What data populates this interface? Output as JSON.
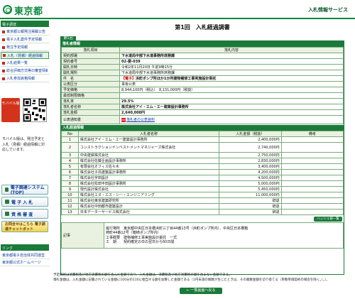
{
  "header": {
    "logo_text": "東京都",
    "service": "入札情報サービス"
  },
  "sidebar": {
    "menu_title": "電子調達",
    "menu_items": [
      {
        "label": "東京都公報発注掲載公告",
        "boxed": false
      },
      {
        "label": "電子入札案件予定情報",
        "boxed": false
      },
      {
        "label": "発注予定情報",
        "boxed": false
      },
      {
        "label": "入札（見積）経過情報",
        "boxed": true
      },
      {
        "label": "入札結果一覧",
        "boxed": false
      },
      {
        "label": "総合評価方式等の審査情報",
        "boxed": false
      },
      {
        "label": "入札参加資格情報",
        "boxed": false
      }
    ],
    "mobile_label": "モバイル版",
    "mobile_note": "モバイル版は、発注予定と入札（見積）経過情報に対応しています。",
    "system_buttons": [
      {
        "label": "電子調達システム(TOP)"
      },
      {
        "label": "電 子 入 札"
      },
      {
        "label": "資 格 審 査"
      }
    ],
    "gold_button": "お問合せはこちら 電子調達チャットボット",
    "links_title": "リンク",
    "links": [
      "東京都電子自治体共同運営",
      "東京都公式ホームページ"
    ]
  },
  "main": {
    "page_title": "第1回　入札経過調書",
    "round_tab": "第1回",
    "section_info": "落札者情報",
    "info_header": {
      "item": "落札項目",
      "content": "落札内容"
    },
    "info_rows": [
      {
        "label": "契約部署",
        "value": "下水道局中部下水道事務所庶務課",
        "bold": true
      },
      {
        "label": "契約番号",
        "value": "02-要-039",
        "bold": true
      },
      {
        "label": "開札日時",
        "value": "令和2年11月20日 午前9時15分",
        "bold": false
      },
      {
        "label": "開札場所",
        "value": "下水道局中部下水道事務所庶務課",
        "bold": false
      },
      {
        "label": "件　名",
        "value_prefix": "【電子】",
        "value": "浜町ポンプ所ほか1か所建物補修工事実施設計委託",
        "bold": true
      },
      {
        "label": "公表区分",
        "value": "事後公表",
        "bold": false
      },
      {
        "label": "予定価格",
        "value": "8,944,100円（税込）　8,131,000円（税抜）",
        "bold": false
      },
      {
        "label": "最低制限価格",
        "value": "",
        "bold": false
      },
      {
        "label": "落札率",
        "value": "29.5%",
        "bold": true
      },
      {
        "label": "落札者名称",
        "value": "株式会社アイ・エム・エー建築設計事務所",
        "bold": true
      },
      {
        "label": "落札金額",
        "value": "2,640,000円",
        "bold": true
      }
    ],
    "notice_label": "公表通知書",
    "notice_link": "落札者の公表資料",
    "section_bids": "入札経過情報",
    "bid_header": {
      "no": "No",
      "name": "入札者名称",
      "amount": "入札金額（税抜）",
      "note": "備考"
    },
    "bids": [
      {
        "no": "1",
        "name": "株式会社アイ・エム・エー建築設計事務所",
        "amount": "2,400,000円",
        "note": ""
      },
      {
        "no": "2",
        "name": "コンストラクションインベストメントマネジャーズ株式会社",
        "amount": "2,740,000円",
        "note": ""
      },
      {
        "no": "3",
        "name": "中央建鉄株式会社",
        "amount": "2,750,000円",
        "note": ""
      },
      {
        "no": "4",
        "name": "株式会社佐藤企画設計事務所",
        "amount": "2,830,000円",
        "note": ""
      },
      {
        "no": "5",
        "name": "有限会社オフィス佐々木",
        "amount": "3,400,000円",
        "note": ""
      },
      {
        "no": "6",
        "name": "株式会社子島建築設計事務所",
        "amount": "4,200,000円",
        "note": ""
      },
      {
        "no": "7",
        "name": "株式会社宇田設計",
        "amount": "4,500,000円",
        "note": ""
      },
      {
        "no": "8",
        "name": "株式会社松田平田設計事務所",
        "amount": "5,000,000円",
        "note": ""
      },
      {
        "no": "9",
        "name": "現代設計株式会社",
        "amount": "5,450,000円",
        "note": ""
      },
      {
        "no": "10",
        "name": "株式会社エヌ・エス・シー・エンジニアリング",
        "amount": "11,000,000円",
        "note": ""
      },
      {
        "no": "11",
        "name": "株式会社東京建築研究所",
        "amount": "辞退",
        "note": ""
      },
      {
        "no": "12",
        "name": "株式会社中田都市建築設計",
        "amount": "辞退",
        "note": ""
      },
      {
        "no": "13",
        "name": "日本データーサービス株式会社",
        "amount": "辞退",
        "note": ""
      }
    ],
    "hash_button": "ハッシュ値一覧",
    "memo_label": "記事",
    "memo_lines": [
      "履行場所　東京都中央区日本橋浜町三丁目44番13号（浜町ポンプ所内）、中央区日本橋箱",
      "崎町44番12号（箱崎ポンプ所内）",
      "工事概要　建物補修工事実施設計委託　一式",
      "工　期　　契約確定の日の翌日から60日間"
    ],
    "footnote_lines": [
      "予定価格は消費税及び地方消費税の額を含んだ金額であり、入札金額は、消費税及び地方消費税の額を含まない金額である。",
      "落札金額は、入札金額に記載されている金額に100分の110に相当する額を加算した金額である（1円未満の端数が生じたときは、その端数金額を切り捨てる（単数単価契約の場合を除く。）。）。"
    ],
    "back_button": "← 一覧画面へ戻る"
  }
}
